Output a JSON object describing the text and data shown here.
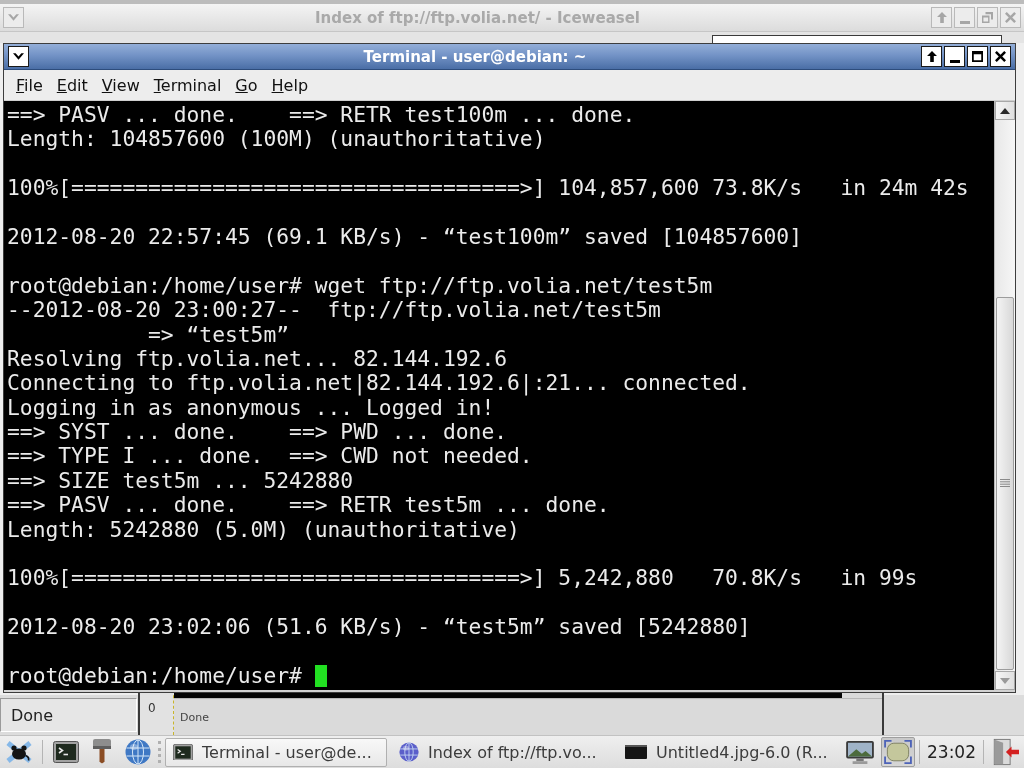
{
  "browser_window": {
    "title": "Index of ftp://ftp.volia.net/ - Iceweasel",
    "active": false,
    "maximized": true,
    "status": "Done"
  },
  "terminal_window": {
    "title": "Terminal - user@debian: ~",
    "active": true,
    "maximized": false,
    "menu": [
      "File",
      "Edit",
      "View",
      "Terminal",
      "Go",
      "Help"
    ],
    "output_blocks": [
      [
        "==> PASV ... done.    ==> RETR test100m ... done.",
        "Length: 104857600 (100M) (unauthoritative)"
      ],
      [
        "100%[===================================>] 104,857,600 73.8K/s   in 24m 42s"
      ],
      [
        "2012-08-20 22:57:45 (69.1 KB/s) - “test100m” saved [104857600]"
      ],
      [
        "root@debian:/home/user# wget ftp://ftp.volia.net/test5m",
        "--2012-08-20 23:00:27--  ftp://ftp.volia.net/test5m",
        "           => “test5m”",
        "Resolving ftp.volia.net... 82.144.192.6",
        "Connecting to ftp.volia.net|82.144.192.6|:21... connected.",
        "Logging in as anonymous ... Logged in!",
        "==> SYST ... done.    ==> PWD ... done.",
        "==> TYPE I ... done.  ==> CWD not needed.",
        "==> SIZE test5m ... 5242880",
        "==> PASV ... done.    ==> RETR test5m ... done.",
        "Length: 5242880 (5.0M) (unauthoritative)"
      ],
      [
        "100%[===================================>] 5,242,880   70.8K/s   in 99s"
      ],
      [
        "2012-08-20 23:02:06 (51.6 KB/s) - “test5m” saved [5242880]"
      ]
    ],
    "prompt": "root@debian:/home/user#",
    "cursor_visible": true
  },
  "image_window": {
    "ruler_label": "0",
    "status": "Done"
  },
  "taskbar": {
    "launchers": [
      {
        "kind": "mouse"
      },
      {
        "kind": "terminal"
      },
      {
        "kind": "brush"
      },
      {
        "kind": "globe"
      }
    ],
    "tasks": [
      {
        "label": "Terminal - user@de...",
        "kind": "terminal",
        "selected": true
      },
      {
        "label": "Index of ftp://ftp.vo...",
        "kind": "browser",
        "selected": false
      },
      {
        "label": "Untitled4.jpg-6.0 (R...",
        "kind": "image",
        "selected": false
      }
    ],
    "tray": [
      {
        "kind": "monitor",
        "pressed": false
      },
      {
        "kind": "frame",
        "pressed": true
      }
    ],
    "clock": "23:02"
  }
}
